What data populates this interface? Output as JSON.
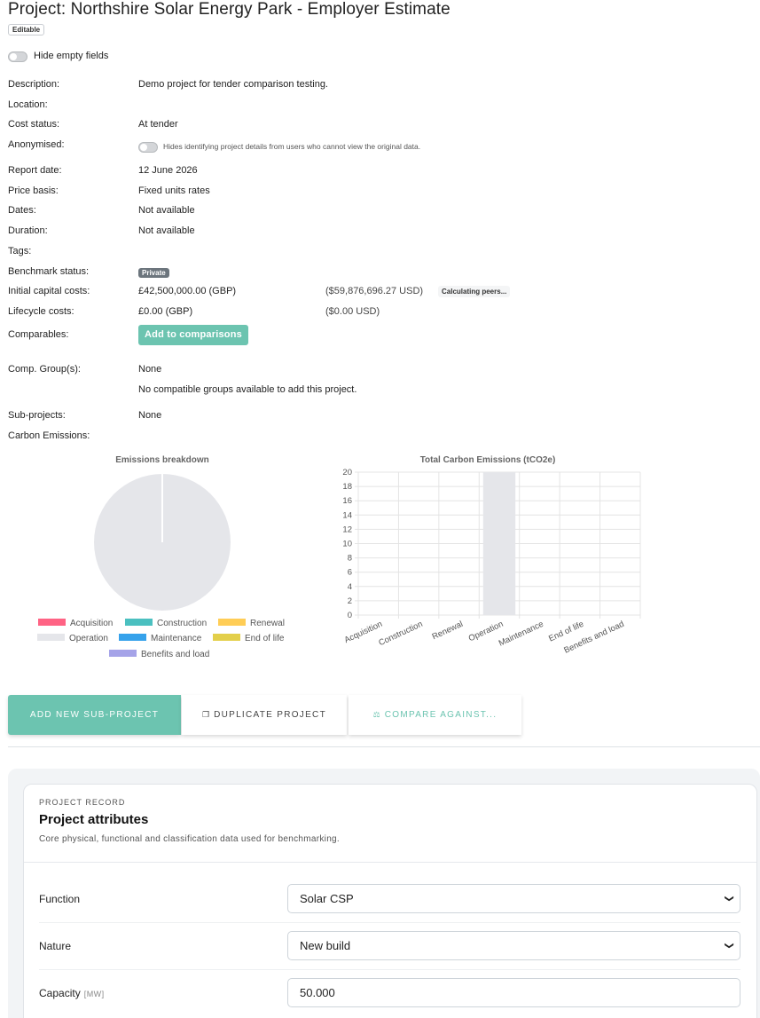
{
  "header": {
    "title": "Project: Northshire Solar Energy Park - Employer Estimate",
    "editable_badge": "Editable",
    "hide_empty_label": "Hide empty fields"
  },
  "details": {
    "description_label": "Description:",
    "description_value": "Demo project for tender comparison testing.",
    "location_label": "Location:",
    "cost_status_label": "Cost status:",
    "cost_status_value": "At tender",
    "anonymised_label": "Anonymised:",
    "anonymised_hint": "Hides identifying project details from users who cannot view the original data.",
    "report_date_label": "Report date:",
    "report_date_value": "12 June 2026",
    "price_basis_label": "Price basis:",
    "price_basis_value": "Fixed units rates",
    "dates_label": "Dates:",
    "dates_value": "Not available",
    "duration_label": "Duration:",
    "duration_value": "Not available",
    "tags_label": "Tags:",
    "benchmark_label": "Benchmark status:",
    "benchmark_badge": "Private",
    "icc_label": "Initial capital costs:",
    "icc_value": "£42,500,000.00 (GBP)",
    "icc_usd": "($59,876,696.27 USD)",
    "icc_calc_badge": "Calculating peers...",
    "lcc_label": "Lifecycle costs:",
    "lcc_value": "£0.00 (GBP)",
    "lcc_usd": "($0.00 USD)",
    "comparables_label": "Comparables:",
    "add_comparison_button": "Add to comparisons",
    "comp_group_label": "Comp. Group(s):",
    "comp_group_value": "None",
    "comp_group_note": "No compatible groups available to add this project.",
    "subprojects_label": "Sub-projects:",
    "subprojects_value": "None",
    "carbon_label": "Carbon Emissions:"
  },
  "chart_data": [
    {
      "type": "pie",
      "title": "Emissions breakdown",
      "categories": [
        "Acquisition",
        "Construction",
        "Renewal",
        "Operation",
        "Maintenance",
        "End of life",
        "Benefits and load"
      ],
      "values": [
        0,
        0,
        0,
        100,
        0,
        0,
        0
      ],
      "colors": [
        "#ff6384",
        "#4bc0c0",
        "#ffcd56",
        "#e5e6ea",
        "#36a2eb",
        "#e3cf4a",
        "#a5a3e8"
      ],
      "legend": "bottom"
    },
    {
      "type": "bar",
      "title": "Total Carbon Emissions (tCO2e)",
      "categories": [
        "Acquisition",
        "Construction",
        "Renewal",
        "Operation",
        "Maintenance",
        "End of life",
        "Benefits and load"
      ],
      "values": [
        0,
        0,
        0,
        20,
        0,
        0,
        0
      ],
      "ylim": [
        0,
        20
      ],
      "yticks": [
        0,
        2,
        4,
        6,
        8,
        10,
        12,
        14,
        16,
        18,
        20
      ],
      "grid": true,
      "bar_color": "#e5e6ea"
    }
  ],
  "actions": {
    "add_subproject": "ADD NEW SUB-PROJECT",
    "duplicate": "DUPLICATE PROJECT",
    "compare": "COMPARE AGAINST..."
  },
  "record": {
    "eyebrow": "PROJECT RECORD",
    "title": "Project attributes",
    "subtitle": "Core physical, functional and classification data used for benchmarking.",
    "function_label": "Function",
    "function_value": "Solar CSP",
    "nature_label": "Nature",
    "nature_value": "New build",
    "capacity_label": "Capacity",
    "capacity_unit": "[MW]",
    "capacity_value": "50.000"
  },
  "icons": {
    "duplicate": "copy-icon",
    "compare": "scale-icon",
    "select": "chevron-down-icon"
  }
}
